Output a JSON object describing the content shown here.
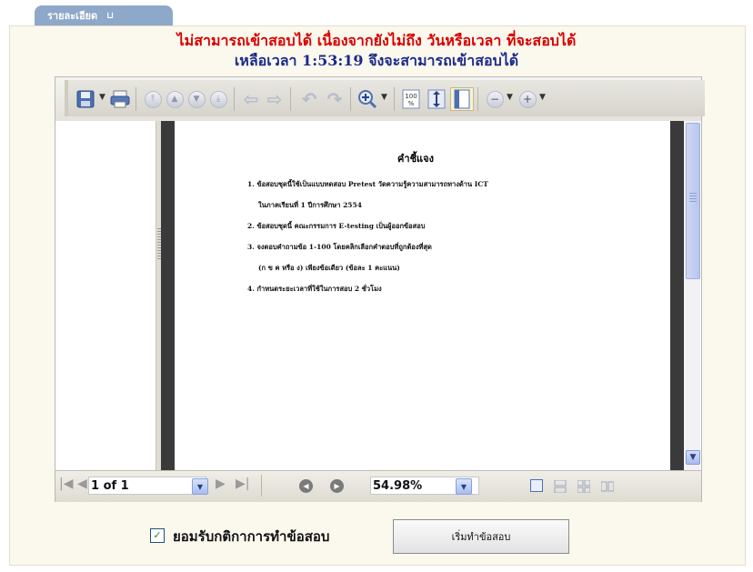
{
  "tab": {
    "label": "รายละเอียด",
    "glyph": "⊔"
  },
  "message": {
    "line1": "ไม่สามารถเข้าสอบได้ เนื่องจากยังไม่ถึง วันหรือเวลา ที่จะสอบได้",
    "line2": "เหลือเวลา 1:53:19 จึงจะสามารถเข้าสอบได้",
    "line1_color": "#d80000",
    "line2_color": "#1a2a8a"
  },
  "document": {
    "title": "คำชี้แจง",
    "lines": [
      "1.  ข้อสอบชุดนี้ใช้เป็นแบบทดสอบ Pretest วัดความรู้ความสามารถทางด้าน ICT",
      "ในภาคเรียนที่ 1  ปีการศึกษา 2554",
      "2.  ข้อสอบชุดนี้ คณะกรรมการ E-testing เป็นผู้ออกข้อสอบ",
      "3.  จงตอบคำถามข้อ 1-100 โดยคลิกเลือกคำตอบที่ถูกต้องที่สุด",
      "(ก ข ค หรือ ง)  เพียงข้อเดียว (ข้อละ 1 คะแนน)",
      "4.  กำหนดระยะเวลาที่ใช้ในการสอบ  2 ชั่วโมง"
    ]
  },
  "navigation": {
    "page": "1 of 1",
    "zoom": "54.98%"
  },
  "accept": {
    "label": "ยอมรับกติกาการทำข้อสอบ",
    "checked": true,
    "button": "เริ่มทำข้อสอบ"
  },
  "icons": {
    "toolbar": [
      "save-icon",
      "print-icon",
      "first-page-icon",
      "prev-page-icon",
      "next-page-icon",
      "last-page-icon",
      "back-icon",
      "forward-icon",
      "undo-icon",
      "redo-icon",
      "zoom-in-icon",
      "actual-size-icon",
      "fit-page-icon",
      "fit-width-icon",
      "zoom-out-circle-icon",
      "zoom-in-circle-icon"
    ]
  }
}
